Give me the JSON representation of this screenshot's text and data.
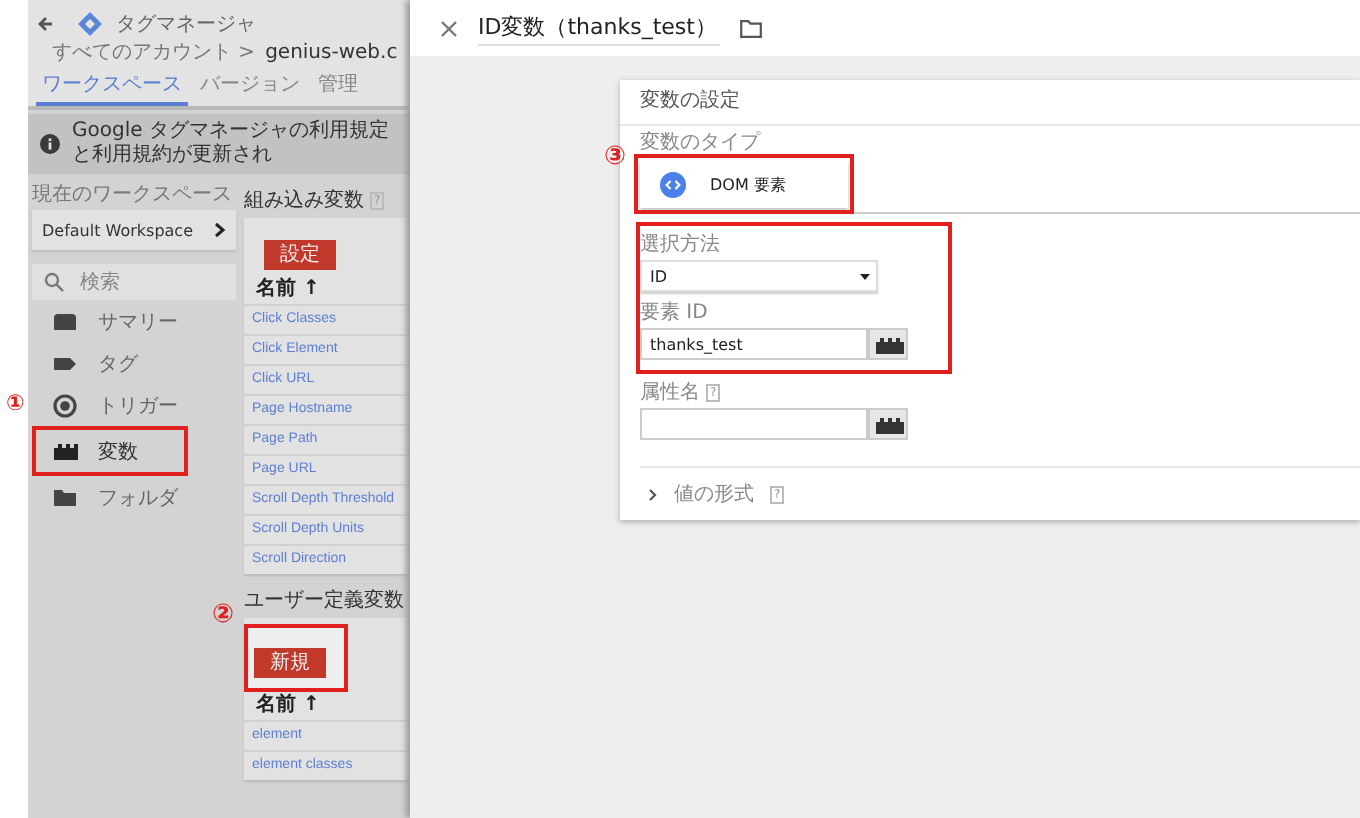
{
  "app": {
    "header": {
      "product": "タグマネージャ",
      "account_path": "すべてのアカウント >",
      "container": "genius-web.c"
    },
    "tabs": [
      {
        "label": "ワークスペース",
        "selected": true
      },
      {
        "label": "バージョン",
        "selected": false
      },
      {
        "label": "管理",
        "selected": false
      }
    ],
    "notice": "Google タグマネージャの利用規定と利用規約が更新され",
    "sidebar": {
      "workspace_label": "現在のワークスペース",
      "workspace": "Default Workspace",
      "search_placeholder": "検索",
      "items": [
        {
          "kind": "summary",
          "label": "サマリー",
          "selected": false,
          "highlighted": false
        },
        {
          "kind": "tag",
          "label": "タグ",
          "selected": false,
          "highlighted": false
        },
        {
          "kind": "trigger",
          "label": "トリガー",
          "selected": false,
          "highlighted": false,
          "marker": "①"
        },
        {
          "kind": "variable",
          "label": "変数",
          "selected": true,
          "highlighted": true
        },
        {
          "kind": "folder",
          "label": "フォルダ",
          "selected": false,
          "highlighted": false
        }
      ]
    },
    "builtin": {
      "title": "組み込み変数",
      "help": "?",
      "button": "設定",
      "column": "名前 ↑",
      "rows": [
        "Click Classes",
        "Click Element",
        "Click URL",
        "Page Hostname",
        "Page Path",
        "Page URL",
        "Scroll Depth Threshold",
        "Scroll Depth Units",
        "Scroll Direction"
      ]
    },
    "user_defined": {
      "title": "ユーザー定義変数",
      "marker": "②",
      "button": "新規",
      "button_highlighted": true,
      "column": "名前 ↑",
      "rows": [
        "element",
        "element classes"
      ]
    }
  },
  "panel": {
    "title": "ID変数（thanks_test）",
    "card": {
      "title": "変数の設定",
      "type_label": "変数のタイプ",
      "type": {
        "name": "DOM 要素",
        "marker": "③",
        "highlighted": true
      },
      "field_groups": [
        {
          "highlighted": true,
          "fields": [
            {
              "kind": "select",
              "label": "選択方法",
              "value": "ID"
            },
            {
              "kind": "input",
              "label": "要素 ID",
              "value": "thanks_test"
            }
          ]
        },
        {
          "highlighted": false,
          "fields": [
            {
              "kind": "input",
              "label": "属性名",
              "help": "?"
            }
          ]
        }
      ],
      "format": {
        "label": "値の形式",
        "help": "?"
      }
    }
  }
}
